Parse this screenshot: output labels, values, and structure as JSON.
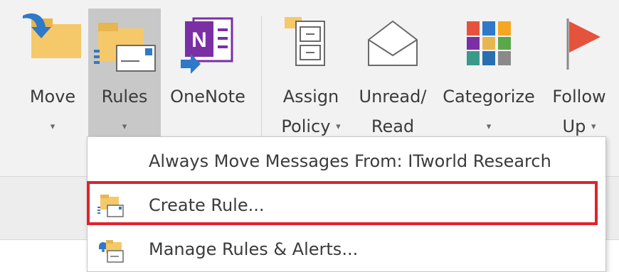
{
  "ribbon": {
    "buttons": [
      {
        "label": "Move",
        "has_dropdown": true
      },
      {
        "label": "Rules",
        "has_dropdown": true,
        "active": true
      },
      {
        "label": "OneNote"
      },
      {
        "label_line1": "Assign",
        "label_line2": "Policy",
        "has_dropdown": true
      },
      {
        "label_line1": "Unread/",
        "label_line2": "Read"
      },
      {
        "label": "Categorize",
        "has_dropdown": true
      },
      {
        "label_line1": "Follow",
        "label_line2": "Up",
        "has_dropdown": true
      }
    ],
    "caret": "▾"
  },
  "menu": {
    "items": [
      {
        "label": "Always Move Messages From: ITworld Research"
      },
      {
        "label": "Create Rule...",
        "highlighted": true
      },
      {
        "label": "Manage Rules & Alerts..."
      }
    ]
  },
  "colors": {
    "ribbon_bg": "#f2f2f2",
    "active_button_bg": "#c8c8c8",
    "highlight_border": "#e0222b",
    "folder_yellow": "#f5c869",
    "onenote_purple": "#7b2fa5",
    "arrow_blue": "#2e79c8",
    "flag_red": "#e5533c"
  }
}
